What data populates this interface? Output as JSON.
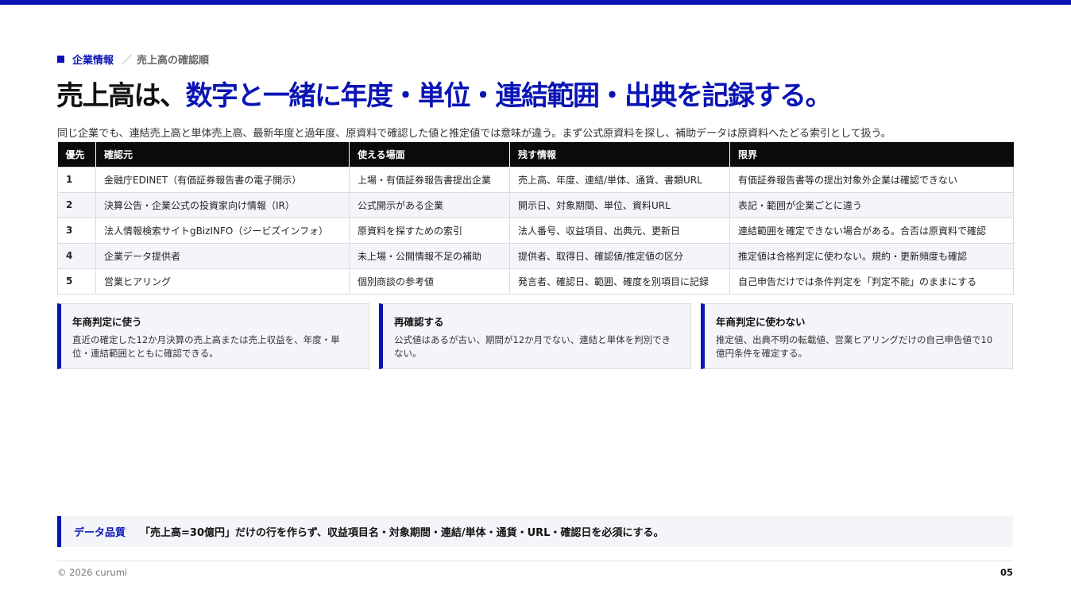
{
  "colors": {
    "accent": "#0a14b4",
    "header_bg": "#0b0b0b",
    "row_alt": "#f3f5f9"
  },
  "breadcrumb": {
    "category": "企業情報",
    "separator": "／",
    "page": "売上高の確認順"
  },
  "headline": {
    "lead": "売上高は、",
    "emphasis": "数字と一緒に年度・単位・連結範囲・出典を記録する。"
  },
  "lede": "同じ企業でも、連結売上高と単体売上高、最新年度と過年度、原資料で確認した値と推定値では意味が違う。まず公式原資料を探し、補助データは原資料へたどる索引として扱う。",
  "table": {
    "headers": [
      "優先",
      "確認元",
      "使える場面",
      "残す情報",
      "限界"
    ],
    "rows": [
      [
        "1",
        "金融庁EDINET（有価証券報告書の電子開示）",
        "上場・有価証券報告書提出企業",
        "売上高、年度、連結/単体、通貨、書類URL",
        "有価証券報告書等の提出対象外企業は確認できない"
      ],
      [
        "2",
        "決算公告・企業公式の投資家向け情報（IR）",
        "公式開示がある企業",
        "開示日、対象期間、単位、資料URL",
        "表記・範囲が企業ごとに違う"
      ],
      [
        "3",
        "法人情報検索サイトgBizINFO（ジービズインフォ）",
        "原資料を探すための索引",
        "法人番号、収益項目、出典元、更新日",
        "連結範囲を確定できない場合がある。合否は原資料で確認"
      ],
      [
        "4",
        "企業データ提供者",
        "未上場・公開情報不足の補助",
        "提供者、取得日、確認値/推定値の区分",
        "推定値は合格判定に使わない。規約・更新頻度も確認"
      ],
      [
        "5",
        "営業ヒアリング",
        "個別商談の参考値",
        "発言者、確認日、範囲、確度を別項目に記録",
        "自己申告だけでは条件判定を「判定不能」のままにする"
      ]
    ]
  },
  "cards": [
    {
      "title": "年商判定に使う",
      "body": "直近の確定した12か月決算の売上高または売上収益を、年度・単位・連結範囲とともに確認できる。"
    },
    {
      "title": "再確認する",
      "body": "公式値はあるが古い、期間が12か月でない、連結と単体を判別できない。"
    },
    {
      "title": "年商判定に使わない",
      "body": "推定値、出典不明の転載値、営業ヒアリングだけの自己申告値で10億円条件を確定する。"
    }
  ],
  "quality": {
    "label": "データ品質",
    "text": "「売上高=30億円」だけの行を作らず、収益項目名・対象期間・連結/単体・通貨・URL・確認日を必須にする。"
  },
  "footer": {
    "copyright": "© 2026 curumi",
    "page_number": "05"
  }
}
